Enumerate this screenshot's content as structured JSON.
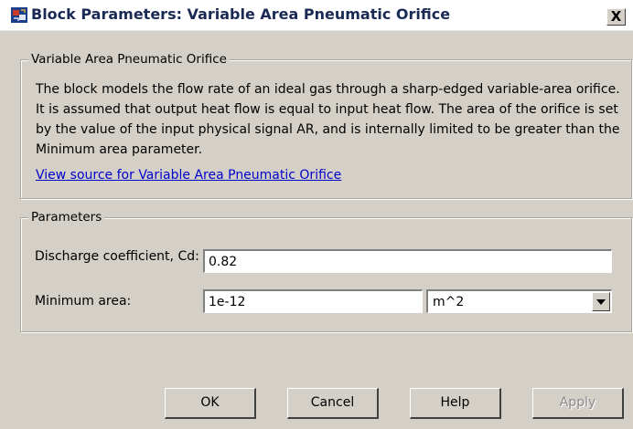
{
  "window": {
    "title": "Block Parameters: Variable Area Pneumatic Orifice",
    "close_glyph": "X"
  },
  "description": {
    "group_title": "Variable Area Pneumatic Orifice",
    "text": "The block models the flow rate of an ideal gas through a sharp-edged variable-area orifice. It is assumed that output heat flow is equal to input heat flow. The area of the orifice is set by the value of the input physical signal AR, and is internally limited to be greater than the Minimum area parameter.",
    "link": "View source for Variable Area Pneumatic Orifice"
  },
  "parameters": {
    "group_title": "Parameters",
    "discharge_label": "Discharge coefficient, Cd:",
    "discharge_value": "0.82",
    "min_area_label": "Minimum area:",
    "min_area_value": "1e-12",
    "min_area_unit": "m^2"
  },
  "buttons": {
    "ok": "OK",
    "cancel": "Cancel",
    "help": "Help",
    "apply": "Apply"
  },
  "colors": {
    "dialog_bg": "#d4d0c8",
    "link": "#0000cc",
    "title_text": "#1a2a55"
  },
  "icons": {
    "app": "simulink-block-icon",
    "close": "close-icon",
    "dropdown": "chevron-down-icon"
  }
}
